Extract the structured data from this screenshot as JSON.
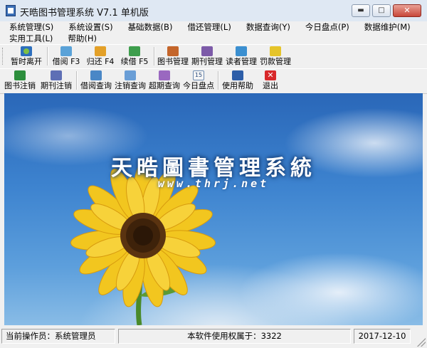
{
  "window": {
    "title": "天晧图书管理系统 V7.1 单机版",
    "controls": {
      "minimize": "▬",
      "maximize": "□",
      "close": "✕"
    }
  },
  "menu": {
    "row1": [
      "系统管理(S)",
      "系统设置(S)",
      "基础数据(B)",
      "借还管理(L)",
      "数据查询(Y)",
      "今日盘点(P)",
      "数据维护(M)"
    ],
    "row2": [
      "实用工具(L)",
      "帮助(H)"
    ]
  },
  "toolbar1": {
    "leave": "暂时离开",
    "borrow": "借阅 F3",
    "return": "归还 F4",
    "renew": "续借 F5",
    "books": "图书管理",
    "periodicals": "期刊管理",
    "readers": "读者管理",
    "fines": "罚款管理"
  },
  "toolbar2": {
    "book_cancel": "图书注销",
    "periodical_cancel": "期刊注销",
    "borrow_query": "借阅查询",
    "cancel_query": "注销查询",
    "overdue_query": "超期查询",
    "daily_check": "今日盘点",
    "help": "使用帮助",
    "exit": "退出",
    "calendar_day": "15"
  },
  "splash": {
    "title": "天晧圖書管理系統",
    "url": "www.thrj.net"
  },
  "status": {
    "operator": "当前操作员：系统管理员",
    "license": "本软件使用权属于：3322",
    "date": "2017-12-10"
  },
  "colors": {
    "sky_top": "#2a67b8",
    "sky_bottom": "#89bce6",
    "petal": "#f2c61f",
    "flower_center": "#5a3310",
    "stem": "#4a8a2a"
  }
}
